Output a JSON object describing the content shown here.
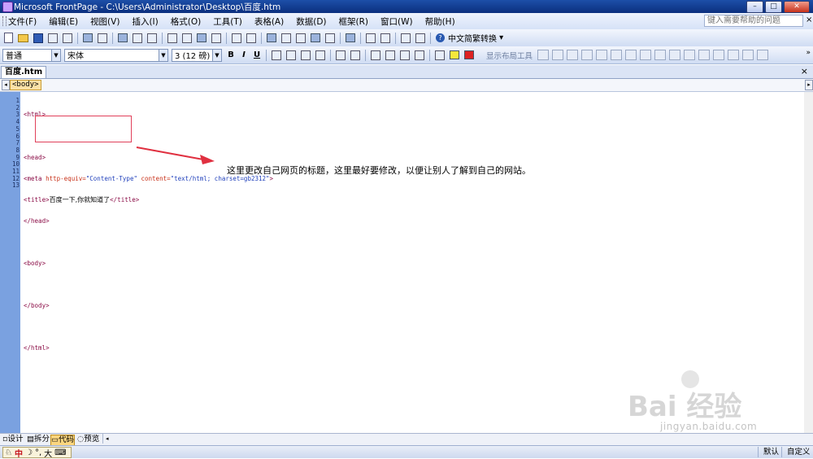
{
  "window": {
    "title": "Microsoft FrontPage - C:\\Users\\Administrator\\Desktop\\百度.htm",
    "minimize": "–",
    "maximize": "□",
    "close": "✕"
  },
  "menubar": {
    "items": [
      "文件(F)",
      "编辑(E)",
      "视图(V)",
      "插入(I)",
      "格式(O)",
      "工具(T)",
      "表格(A)",
      "数据(D)",
      "框架(R)",
      "窗口(W)",
      "帮助(H)"
    ],
    "help_placeholder": "键入需要帮助的问题",
    "help_close": "×"
  },
  "toolbar": {
    "convert_label": "中文简繁转换",
    "style_value": "普通",
    "font_value": "宋体",
    "size_value": "3 (12 磅)",
    "bold": "B",
    "italic": "I",
    "underline": "U",
    "layout_tool": "显示布局工具"
  },
  "document": {
    "tab_name": "百度.htm",
    "tab_close": "×",
    "tag_chip": "<body>"
  },
  "code": {
    "line_numbers": [
      "1",
      "2",
      "3",
      "4",
      "5",
      "6",
      "7",
      "8",
      "9",
      "10",
      "11",
      "12",
      "13"
    ],
    "l1": "<html>",
    "l3": "<head>",
    "l4_tag": "<meta ",
    "l4_attr1": "http-equiv=",
    "l4_val1": "\"Content-Type\"",
    "l4_attr2": " content=",
    "l4_val2": "\"text/html; charset=gb2312\"",
    "l4_end": ">",
    "l5_open": "<title>",
    "l5_text": "百度一下,你就知道了",
    "l5_close": "</title>",
    "l6": "</head>",
    "l8": "<body>",
    "l10": "</body>",
    "l12": "</html>"
  },
  "annotation": {
    "text": "这里更改自己网页的标题，这里最好要修改，以便让别人了解到自己的网站。",
    "color": "#e03040"
  },
  "view_tabs": [
    "设计",
    "拆分",
    "代码",
    "预览"
  ],
  "active_view": "代码",
  "status": {
    "ime": [
      "中",
      "☽",
      "°,",
      "大",
      "⌨"
    ],
    "default": "默认",
    "custom": "自定义"
  },
  "watermark": {
    "brand": "Bai 经验",
    "url": "jingyan.baidu.com"
  }
}
